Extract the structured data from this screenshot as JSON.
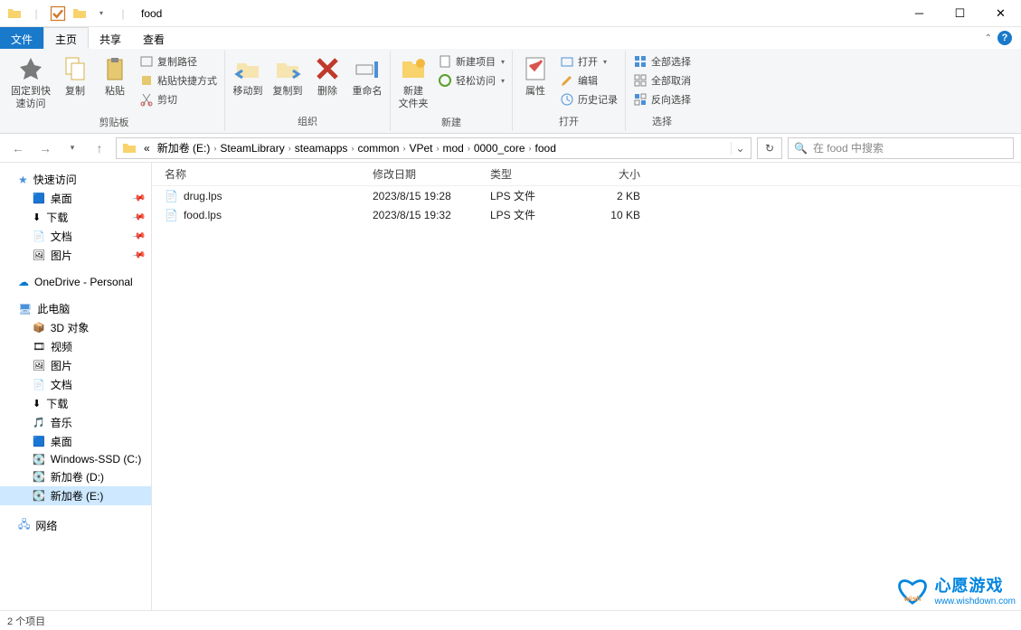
{
  "window": {
    "title": "food"
  },
  "tabs": {
    "file": "文件",
    "home": "主页",
    "share": "共享",
    "view": "查看"
  },
  "ribbon": {
    "clipboard": {
      "pin": "固定到快\n速访问",
      "copy": "复制",
      "paste": "粘贴",
      "copypath": "复制路径",
      "pasteshortcut": "粘贴快捷方式",
      "cut": "剪切",
      "label": "剪贴板"
    },
    "organize": {
      "moveto": "移动到",
      "copyto": "复制到",
      "delete": "删除",
      "rename": "重命名",
      "label": "组织"
    },
    "new": {
      "newfolder": "新建\n文件夹",
      "newitem": "新建项目",
      "easyaccess": "轻松访问",
      "label": "新建"
    },
    "open": {
      "properties": "属性",
      "open": "打开",
      "edit": "编辑",
      "history": "历史记录",
      "label": "打开"
    },
    "select": {
      "all": "全部选择",
      "none": "全部取消",
      "invert": "反向选择",
      "label": "选择"
    }
  },
  "breadcrumbs": [
    "新加卷 (E:)",
    "SteamLibrary",
    "steamapps",
    "common",
    "VPet",
    "mod",
    "0000_core",
    "food"
  ],
  "breadcrumb_prefix": "«",
  "search": {
    "placeholder": "在 food 中搜索"
  },
  "columns": {
    "name": "名称",
    "date": "修改日期",
    "type": "类型",
    "size": "大小"
  },
  "files": [
    {
      "name": "drug.lps",
      "date": "2023/8/15 19:28",
      "type": "LPS 文件",
      "size": "2 KB"
    },
    {
      "name": "food.lps",
      "date": "2023/8/15 19:32",
      "type": "LPS 文件",
      "size": "10 KB"
    }
  ],
  "nav": {
    "quick": {
      "label": "快速访问",
      "items": [
        "桌面",
        "下载",
        "文档",
        "图片"
      ]
    },
    "onedrive": "OneDrive - Personal",
    "thispc": {
      "label": "此电脑",
      "items": [
        "3D 对象",
        "视频",
        "图片",
        "文档",
        "下载",
        "音乐",
        "桌面",
        "Windows-SSD (C:)",
        "新加卷 (D:)",
        "新加卷 (E:)"
      ]
    },
    "network": "网络"
  },
  "status": "2 个项目",
  "watermark": {
    "title": "心愿游戏",
    "url": "www.wishdown.com"
  }
}
